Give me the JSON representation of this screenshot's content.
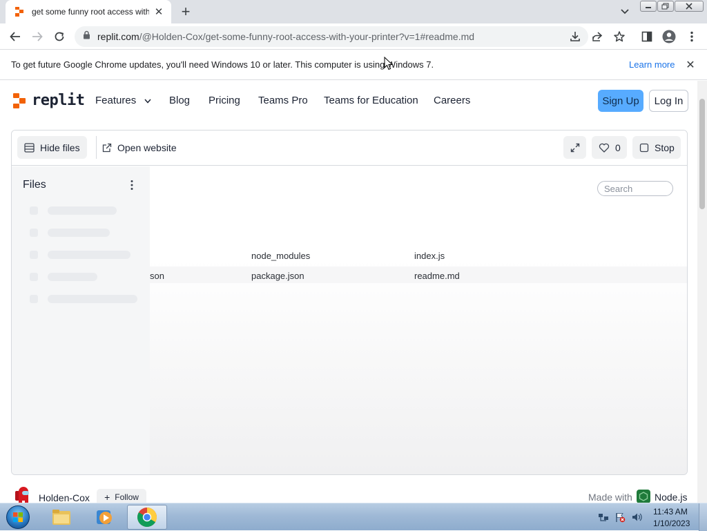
{
  "browser": {
    "tab_title": "get some funny root access with your printer",
    "url_host": "replit.com",
    "url_path": "/@Holden-Cox/get-some-funny-root-access-with-your-printer?v=1#readme.md"
  },
  "infobar": {
    "message": "To get future Google Chrome updates, you'll need Windows 10 or later. This computer is using Windows 7.",
    "link": "Learn more"
  },
  "site_nav": {
    "logo": "replit",
    "items": [
      "Features",
      "Blog",
      "Pricing",
      "Teams Pro",
      "Teams for Education",
      "Careers"
    ],
    "signup": "Sign Up",
    "login": "Log In"
  },
  "repl_toolbar": {
    "hide_files": "Hide files",
    "open_website": "Open website",
    "likes": "0",
    "stop": "Stop"
  },
  "files_panel": {
    "title": "Files"
  },
  "content": {
    "search_placeholder": "Search",
    "files": [
      {
        "name": "node_modules"
      },
      {
        "name": "index.js"
      },
      {
        "name": "son"
      },
      {
        "name": "package.json"
      },
      {
        "name": "readme.md"
      }
    ]
  },
  "footer": {
    "owner": "Holden-Cox",
    "follow": "Follow",
    "made_with": "Made with",
    "runtime": "Node.js"
  },
  "taskbar": {
    "time": "11:43 AM",
    "date": "1/10/2023"
  },
  "colors": {
    "replit_orange": "#f26207",
    "signup_blue": "#57abff",
    "chrome_tab_strip": "#dee1e6",
    "link_blue": "#1a73e8"
  }
}
